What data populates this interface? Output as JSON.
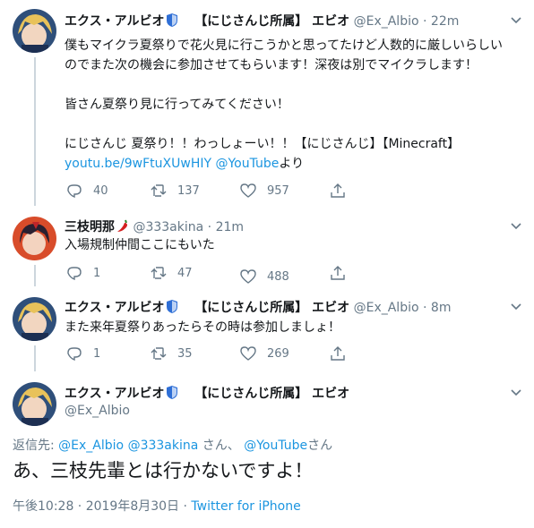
{
  "tweets": [
    {
      "display_name": "エクス・アルビオ",
      "affiliation": "【にじさんじ所属】 エビオ",
      "handle": "@Ex_Albio",
      "time": "22m",
      "text_main": "僕もマイクラ夏祭りで花火見に行こうかと思ってたけど人数的に厳しいらしいのでまた次の機会に参加させてもらいます！深夜は別でマイクラします！\n\n皆さん夏祭り見に行ってみてください！\n\nにじさんじ 夏祭り！！わっしょーい！！【にじさんじ】【Minecraft】",
      "link": "youtu.be/9wFtuXUwHIY",
      "mention": "@YouTube",
      "suffix": "より",
      "replies": "40",
      "retweets": "137",
      "likes": "957"
    },
    {
      "display_name": "三枝明那",
      "handle": "@333akina",
      "time": "21m",
      "text_main": "入場規制仲間ここにもいた",
      "replies": "1",
      "retweets": "47",
      "likes": "488"
    },
    {
      "display_name": "エクス・アルビオ",
      "affiliation": "【にじさんじ所属】 エビオ",
      "handle": "@Ex_Albio",
      "time": "8m",
      "text_main": "また来年夏祭りあったらその時は参加しましょ！",
      "replies": "1",
      "retweets": "35",
      "likes": "269"
    }
  ],
  "focus": {
    "display_name": "エクス・アルビオ",
    "affiliation": "【にじさんじ所属】 エビオ",
    "handle": "@Ex_Albio",
    "reply_prefix": "返信先: ",
    "reply_to_1": "@Ex_Albio",
    "reply_to_2": "@333akina",
    "reply_san_1": " さん、 ",
    "reply_to_3": "@YouTube",
    "reply_san_2": "さん",
    "text": "あ、三枝先輩とは行かないですよ！",
    "timestamp": "午後10:28 · 2019年8月30日 · ",
    "client": "Twitter for iPhone"
  },
  "colors": {
    "link": "#1b95e0",
    "secondary": "#657786",
    "thread_line": "#ccd6dd"
  },
  "icons": [
    "reply-icon",
    "retweet-icon",
    "like-icon",
    "share-icon",
    "chevron-down-icon",
    "shield-icon",
    "chili-icon"
  ]
}
